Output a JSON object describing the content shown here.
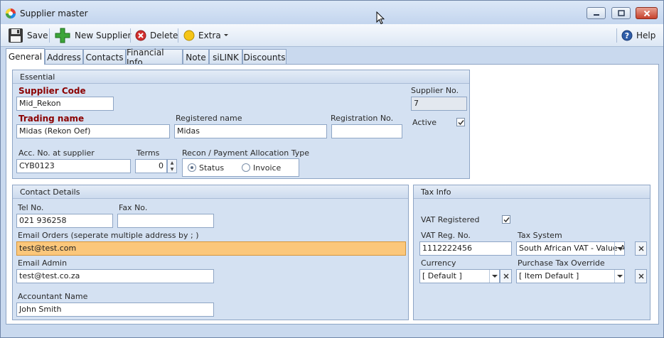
{
  "window": {
    "title": "Supplier master"
  },
  "toolbar": {
    "save_label": "Save",
    "new_label": "New Supplier",
    "delete_label": "Delete",
    "extra_label": "Extra",
    "help_label": "Help"
  },
  "tabs": [
    {
      "label": "General",
      "active": true
    },
    {
      "label": "Address"
    },
    {
      "label": "Contacts"
    },
    {
      "label": "Financial Info"
    },
    {
      "label": "Note"
    },
    {
      "label": "siLINK"
    },
    {
      "label": "Discounts"
    }
  ],
  "essential": {
    "header": "Essential",
    "supplier_code_label": "Supplier Code",
    "supplier_code": "Mid_Rekon",
    "supplier_no_label": "Supplier No.",
    "supplier_no": "7",
    "trading_name_label": "Trading name",
    "trading_name": "Midas (Rekon Oef)",
    "registered_name_label": "Registered name",
    "registered_name": "Midas",
    "registration_no_label": "Registration No.",
    "registration_no": "",
    "active_label": "Active",
    "active": true,
    "acc_no_label": "Acc. No. at supplier",
    "acc_no": "CYB0123",
    "terms_label": "Terms",
    "terms": "0",
    "recon_label": "Recon / Payment Allocation Type",
    "recon_options": [
      "Status",
      "Invoice"
    ],
    "recon_selected": "Status"
  },
  "contact": {
    "header": "Contact Details",
    "tel_label": "Tel No.",
    "tel": "021 936258",
    "fax_label": "Fax No.",
    "fax": "",
    "email_orders_label": "Email Orders (seperate multiple address by ; )",
    "email_orders": "test@test.com",
    "email_admin_label": "Email Admin",
    "email_admin": "test@test.co.za",
    "accountant_label": "Accountant Name",
    "accountant": "John Smith"
  },
  "tax": {
    "header": "Tax Info",
    "vat_registered_label": "VAT Registered",
    "vat_registered": true,
    "vat_reg_no_label": "VAT Reg. No.",
    "vat_reg_no": "1112222456",
    "tax_system_label": "Tax System",
    "tax_system": "South African VAT - Value A...",
    "currency_label": "Currency",
    "currency": "[ Default ]",
    "purchase_tax_label": "Purchase Tax Override",
    "purchase_tax": "[ Item Default ]"
  },
  "colors": {
    "highlight": "#fbc77b",
    "required_label": "#8b0000",
    "group_bg": "#d4e1f2"
  }
}
